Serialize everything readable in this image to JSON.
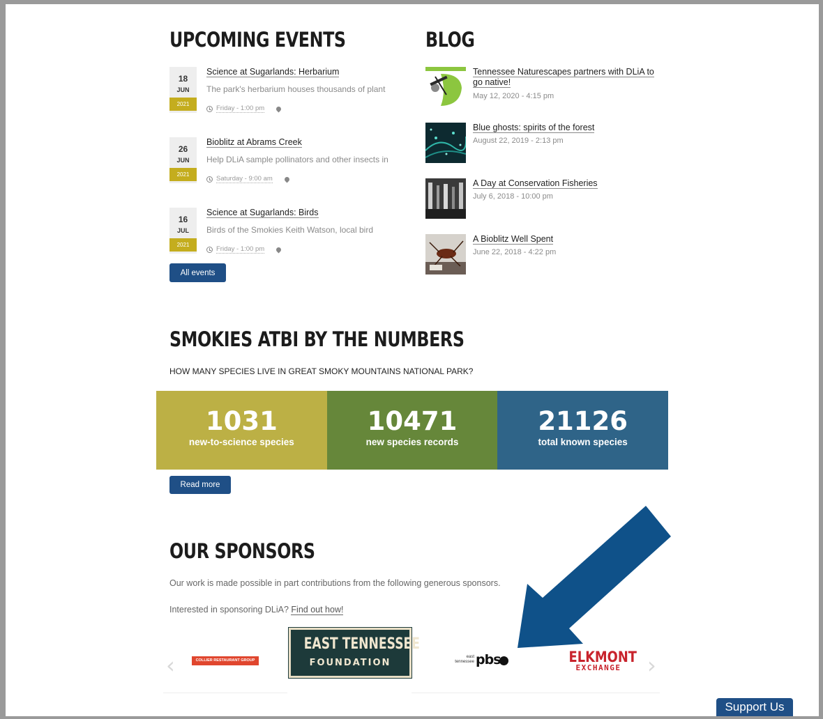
{
  "events": {
    "heading": "UPCOMING EVENTS",
    "items": [
      {
        "day": "18",
        "month": "JUN",
        "year": "2021",
        "title": "Science at Sugarlands: Herbarium",
        "summary": "The park's herbarium houses thousands of plant",
        "time": "Friday - 1:00 pm"
      },
      {
        "day": "26",
        "month": "JUN",
        "year": "2021",
        "title": "Bioblitz at Abrams Creek",
        "summary": "Help DLiA sample pollinators and other insects in",
        "time": "Saturday - 9:00 am"
      },
      {
        "day": "16",
        "month": "JUL",
        "year": "2021",
        "title": "Science at Sugarlands: Birds",
        "summary": "Birds of the Smokies Keith Watson, local bird",
        "time": "Friday - 1:00 pm"
      }
    ],
    "all_events_label": "All events"
  },
  "blog": {
    "heading": "BLOG",
    "posts": [
      {
        "title": "Tennessee Naturescapes partners with DLiA to go native!",
        "date": "May 12, 2020 - 4:15 pm"
      },
      {
        "title": "Blue ghosts: spirits of the forest",
        "date": "August 22, 2019 - 2:13 pm"
      },
      {
        "title": "A Day at Conservation Fisheries",
        "date": "July 6, 2018 - 10:00 pm"
      },
      {
        "title": "A Bioblitz Well Spent",
        "date": "June 22, 2018 - 4:22 pm"
      }
    ]
  },
  "numbers": {
    "heading": "SMOKIES ATBI BY THE NUMBERS",
    "subheading": "HOW MANY SPECIES LIVE IN GREAT SMOKY MOUNTAINS NATIONAL PARK?",
    "stats": [
      {
        "value": "1031",
        "label": "new-to-science species",
        "color": "#bcb045"
      },
      {
        "value": "10471",
        "label": "new species records",
        "color": "#66873a"
      },
      {
        "value": "21126",
        "label": "total known species",
        "color": "#2f6488"
      }
    ],
    "read_more_label": "Read more"
  },
  "sponsors": {
    "heading": "OUR SPONSORS",
    "intro": "Our work is made possible in part contributions from the following generous sponsors.",
    "interested_text": "Interested in sponsoring DLiA?",
    "find_out_link": "Find out how!",
    "logos": {
      "collier": "COLLIER RESTAURANT GROUP",
      "etf_line1": "EAST TENNESSEE",
      "etf_line2": "FOUNDATION",
      "pbs_small1": "east",
      "pbs_small2": "tennessee",
      "pbs_main": "pbs",
      "elkmont_line1": "ELKMONT",
      "elkmont_line2": "EXCHANGE"
    }
  },
  "support_label": "Support Us",
  "colors": {
    "accent_blue": "#1f4f86",
    "date_gold": "#c4ad1e",
    "annotation_arrow": "#0f5189"
  }
}
